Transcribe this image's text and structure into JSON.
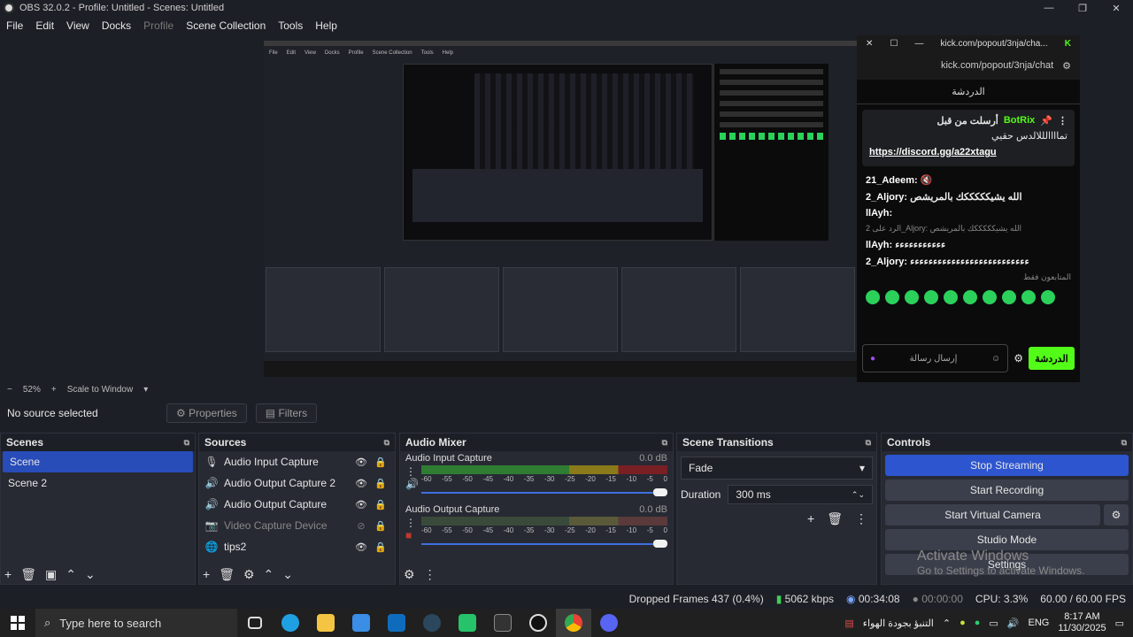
{
  "window": {
    "title": "OBS 32.0.2 - Profile: Untitled - Scenes: Untitled",
    "minimize": "—",
    "restore": "❐",
    "close": "✕"
  },
  "menu": [
    "File",
    "Edit",
    "View",
    "Docks",
    "Profile",
    "Scene Collection",
    "Tools",
    "Help"
  ],
  "preview": {
    "zoom": "52%",
    "scale_mode": "Scale to Window",
    "inner_menu": [
      "File",
      "Edit",
      "View",
      "Docks",
      "Profile",
      "Scene Collection",
      "Tools",
      "Help"
    ]
  },
  "chat_popup": {
    "window_title": "kick.com/popout/3nja/cha...",
    "url": "kick.com/popout/3nja/chat",
    "tab_label": "الدردشة",
    "pinned_by": "أرسلت من قبل",
    "pinned_user": "BotRix",
    "pinned_text": "تماااالللالدس حقيي",
    "pinned_link": "https://discord.gg/a22xtagu",
    "messages": [
      {
        "user": "21_Adeem:",
        "text": ""
      },
      {
        "user": "2_Aljory:",
        "text": "الله يشيكككككك بالمريشص"
      },
      {
        "user": "llAyh:",
        "text": ""
      },
      {
        "user": "",
        "text": "الرد على 2_Aljory: الله يشيكككككك بالمريشص"
      },
      {
        "user": "llAyh:",
        "text": "ءءءءءءءءءءء"
      },
      {
        "user": "2_Aljory:",
        "text": "ءءءءءءءءءءءءءءءءءءءءءءءءءء"
      }
    ],
    "followers_only": "المتابعون فقط",
    "input_placeholder": "إرسال رسالة",
    "send": "الدردشة"
  },
  "source_bar": {
    "selected": "No source selected",
    "properties": "Properties",
    "filters": "Filters"
  },
  "scenes": {
    "title": "Scenes",
    "items": [
      "Scene",
      "Scene 2"
    ]
  },
  "sources": {
    "title": "Sources",
    "items": [
      {
        "label": "Audio Input Capture",
        "icon": "mic-icon"
      },
      {
        "label": "Audio Output Capture 2",
        "icon": "speaker-icon"
      },
      {
        "label": "Audio Output Capture",
        "icon": "speaker-icon"
      },
      {
        "label": "Video Capture Device",
        "icon": "camera-icon"
      },
      {
        "label": "tips2",
        "icon": "globe-icon"
      }
    ]
  },
  "audio_mixer": {
    "title": "Audio Mixer",
    "channels": [
      {
        "name": "Audio Input Capture",
        "db": "0.0 dB",
        "volume": 1.0,
        "level": 0.9
      },
      {
        "name": "Audio Output Capture",
        "db": "0.0 dB",
        "volume": 1.0,
        "level": 0.0
      }
    ],
    "scale": [
      "-60",
      "-55",
      "-50",
      "-45",
      "-40",
      "-35",
      "-30",
      "-25",
      "-20",
      "-15",
      "-10",
      "-5",
      "0"
    ]
  },
  "transitions": {
    "title": "Scene Transitions",
    "selected": "Fade",
    "duration_label": "Duration",
    "duration_value": "300 ms"
  },
  "controls": {
    "title": "Controls",
    "stop_streaming": "Stop Streaming",
    "start_recording": "Start Recording",
    "start_virtual_camera": "Start Virtual Camera",
    "studio_mode": "Studio Mode",
    "settings": "Settings"
  },
  "watermark": {
    "line1": "Activate Windows",
    "line2": "Go to Settings to activate Windows."
  },
  "status": {
    "dropped": "Dropped Frames 437 (0.4%)",
    "bitrate": "5062 kbps",
    "stream_time": "00:34:08",
    "rec_time": "00:00:00",
    "cpu": "CPU: 3.3%",
    "fps": "60.00 / 60.00 FPS"
  },
  "taskbar": {
    "search_placeholder": "Type here to search",
    "weather": "التنبؤ بجودة الهواء",
    "lang": "ENG",
    "time": "8:17 AM",
    "date": "11/30/2025"
  },
  "colors": {
    "accent": "#2d55d0",
    "kick_green": "#53fc18",
    "bg": "#1d1f26",
    "dock": "#272a33"
  }
}
